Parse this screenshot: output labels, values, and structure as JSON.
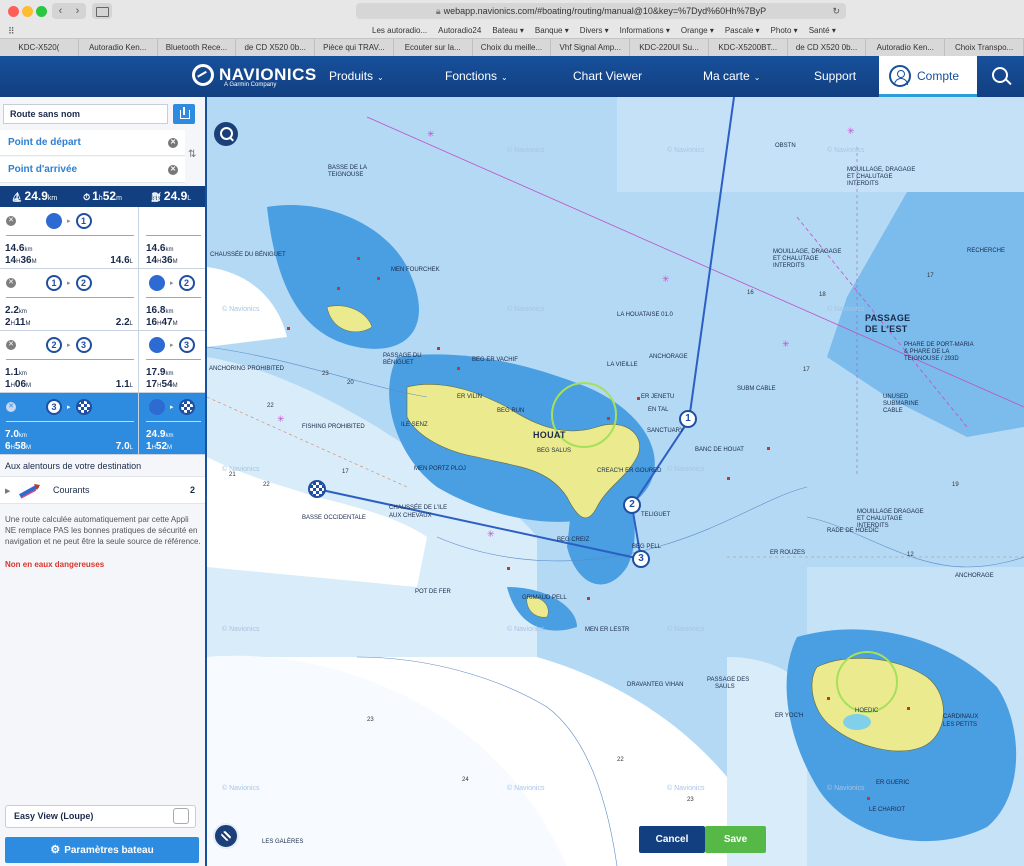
{
  "browser": {
    "url": "webapp.navionics.com/#boating/routing/manual@10&key=%7Dyd%60Hh%7ByP",
    "bookmarks": [
      "Les autoradio...",
      "Autoradio24",
      "Bateau ▾",
      "Banque ▾",
      "Divers ▾",
      "Informations ▾",
      "Orange ▾",
      "Pascale ▾",
      "Photo ▾",
      "Santé ▾"
    ],
    "tabs": [
      "KDC-X520(",
      "Autoradio Ken...",
      "Bluetooth Rece...",
      "de CD X520 0b...",
      "Pièce qui TRAV...",
      "Ecouter sur la...",
      "Choix du meille...",
      "Vhf Signal Amp...",
      "KDC-220UI Su...",
      "KDC-X5200BT...",
      "de CD X520 0b...",
      "Autoradio Ken...",
      "Choix Transpo..."
    ]
  },
  "header": {
    "logo": "NAVIONICS",
    "logo_sub": "A Garmin Company",
    "nav": {
      "produits": "Produits",
      "fonctions": "Fonctions",
      "chart_viewer": "Chart Viewer",
      "ma_carte": "Ma carte",
      "support": "Support"
    },
    "account": "Compte"
  },
  "panel": {
    "route_name": "Route sans nom",
    "start_placeholder": "Point de départ",
    "end_placeholder": "Point d'arrivée",
    "totals": {
      "distance": "24.9",
      "distance_unit": "km",
      "duration_a": "1",
      "duration_a_unit": "h",
      "duration_b": "52",
      "duration_b_unit": "m",
      "fuel": "24.9",
      "fuel_unit": "L"
    },
    "legs": [
      {
        "from": "",
        "to": "1",
        "dist": "14.6",
        "dist_unit": "km",
        "time_h": "14",
        "time_m": "36",
        "fuel": "14.6",
        "fuel_unit": "L",
        "r_dist": "14.6",
        "r_time_h": "14",
        "r_time_m": "36",
        "r_to": "1",
        "active": false
      },
      {
        "from": "1",
        "to": "2",
        "dist": "2.2",
        "dist_unit": "km",
        "time_h": "2",
        "time_m": "11",
        "fuel": "2.2",
        "fuel_unit": "L",
        "r_dist": "16.8",
        "r_time_h": "16",
        "r_time_m": "47",
        "r_to": "2",
        "active": false
      },
      {
        "from": "2",
        "to": "3",
        "dist": "1.1",
        "dist_unit": "km",
        "time_h": "1",
        "time_m": "06",
        "fuel": "1.1",
        "fuel_unit": "L",
        "r_dist": "17.9",
        "r_time_h": "17",
        "r_time_m": "54",
        "r_to": "3",
        "active": false
      },
      {
        "from": "3",
        "to": "",
        "dist": "7.0",
        "dist_unit": "km",
        "time_h": "6",
        "time_m": "58",
        "fuel": "7.0",
        "fuel_unit": "L",
        "r_dist": "24.9",
        "r_time_h": "1",
        "r_time_m": "52",
        "r_to": "",
        "active": true
      }
    ],
    "around_title": "Aux alentours de votre destination",
    "currents_label": "Courants",
    "currents_count": "2",
    "disclaimer": "Une route calculée automatiquement par cette Appli NE remplace PAS les bonnes pratiques de sécurité en navigation et ne peut être la seule source de référence.",
    "danger": "Non en eaux dangereuses",
    "easy_view": "Easy View (Loupe)",
    "params_button": "Paramètres bateau"
  },
  "map": {
    "labels": {
      "houat": "HOUAT",
      "passage_est": "PASSAGE",
      "passage_est2": "DE L'EST",
      "hoedic": "HOEDIC",
      "beg_salus": "BEG SALUS",
      "er_vilin": "ER VILIN",
      "beg_run": "BEG RUN",
      "sanctuary": "SANCTUARY",
      "banc_houat": "BANC DE HOUAT",
      "la_vieille": "LA VIEILLE",
      "anchorage1": "ANCHORAGE",
      "anchorage2": "ANCHORAGE",
      "fishing": "FISHING PROHIBITED",
      "anch_prohib": "ANCHORING PROHIBITED",
      "chaussee": "CHAUSSÉE DE L'ILE",
      "chaussee2": "AUX CHEVAUX",
      "basse_occ": "BASSE OCCIDENTALE",
      "grimaud": "GRIMAUD PELL",
      "men_portz": "MEN PORTZ PLOJ",
      "creach": "CREAC'H ER GOURED",
      "rade_hoedic": "RADE DE HOEDIC",
      "cardinaux": "CARDINAUX",
      "les_petits": "LES PETITS",
      "mouillage1": "MOUILLAGE, DRAGAGE",
      "mouillage1b": "ET CHALUTAGE",
      "mouillage1c": "INTERDITS",
      "mouillage2": "MOUILLAGE, DRAGAGE",
      "mouillage2b": "ET CHALUTAGE",
      "mouillage2c": "INTERDITS",
      "mouillage3": "MOUILLAGE DRAGAGE",
      "mouillage3b": "ET CHALUTAGE",
      "mouillage3c": "INTERDITS",
      "submarine": "SUBM CABLE",
      "unused": "UNUSED",
      "unused2": "SUBMARINE",
      "unused3": "CABLE",
      "phare": "PHARE DE PORT-MARIA",
      "phare2": "& PHARE DE LA",
      "phare3": "TEIGNOUSE / 293D",
      "la_houataise": "LA HOUATAISE 01.0",
      "obstn": "OBSTN",
      "recherche": "RECHERCHE",
      "basse_teignouse": "BASSE DE LA",
      "basse_teignouse2": "TEIGNOUSE",
      "men_fourchek": "MEN FOURCHEK",
      "chaussee_beniguet": "CHAUSSÉE DU BÉNIGUET",
      "passage_beniguet": "PASSAGE DU",
      "passage_beniguet2": "BÉNIGUET",
      "er_jenetu": "ER JENETU",
      "en_tal": "EN TAL",
      "beg_vachif": "BEG ER VACHIF",
      "drann_vihan": "DRAVANTEG VIHAN",
      "passage_sauls": "PASSAGE DES",
      "passage_sauls2": "SAULS",
      "er_rouzes": "ER ROUZES",
      "men_er_lestr": "MEN ER LESTR",
      "pot_de_fer": "POT DE FER",
      "er_gueric": "ER GUERIC",
      "le_chariot": "LE CHARIOT",
      "les_galeres": "LES GALÈRES",
      "ile_senz": "ILE SENZ",
      "beg_creiz": "BEG CREIZ",
      "er_yoc": "ER YOC'H",
      "beg_pell": "BEG PELL",
      "guernic": "TELIGUET"
    },
    "watermark": "© Navionics",
    "waypoints": [
      "1",
      "2",
      "3"
    ],
    "cancel": "Cancel",
    "save": "Save"
  }
}
